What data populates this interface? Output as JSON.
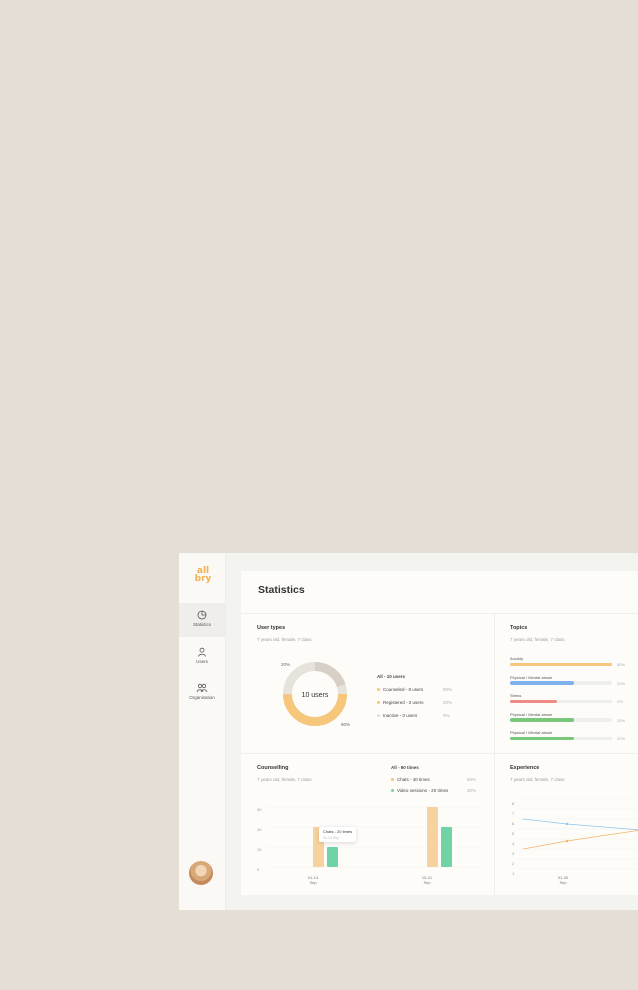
{
  "sidebar": {
    "logo": "all\nbry",
    "items": [
      {
        "label": "Statistics",
        "icon": "pie-chart-icon",
        "active": true
      },
      {
        "label": "Users",
        "icon": "user-icon",
        "active": false
      },
      {
        "label": "Organisation",
        "icon": "group-icon",
        "active": false
      }
    ]
  },
  "page": {
    "title": "Statistics"
  },
  "user_types": {
    "title": "User types",
    "subtitle": "7 years old, female, 7 class",
    "center_label": "10 users",
    "pct_top": "20%",
    "pct_bottom": "80%",
    "summary": "All - 10 users",
    "legend": [
      {
        "label": "Counseled - 8 users",
        "pct": "80%",
        "color": "#f6c67a"
      },
      {
        "label": "Registered - 2 users",
        "pct": "20%",
        "color": "#f6c67a"
      },
      {
        "label": "Inactive - 0 users",
        "pct": "0%",
        "color": "#dddddd"
      }
    ]
  },
  "topics": {
    "title": "Topics",
    "subtitle": "7 years old, female, 7 class",
    "items": [
      {
        "label": "Anxiety",
        "value": 80,
        "pct": "80%",
        "color": "#f6c67a"
      },
      {
        "label": "Physical / Mental abuse",
        "value": 50,
        "pct": "20%",
        "color": "#7fb1ec"
      },
      {
        "label": "Stress",
        "value": 37,
        "pct": "0%",
        "color": "#f08a84"
      },
      {
        "label": "Physical / Mental abuse",
        "value": 50,
        "pct": "20%",
        "color": "#79c77b"
      },
      {
        "label": "Physical / Mental abuse",
        "value": 50,
        "pct": "20%",
        "color": "#79c77b"
      }
    ]
  },
  "counselling": {
    "title": "Counselling",
    "subtitle": "7 years old, female, 7 class",
    "summary": "All - 60 times",
    "legend": [
      {
        "label": "Chats - 40 times",
        "pct": "60%",
        "color": "#f6c67a"
      },
      {
        "label": "Video sessions - 20 times",
        "pct": "30%",
        "color": "#6fd3a5"
      }
    ],
    "y_ticks": [
      "30",
      "20",
      "10",
      "0"
    ],
    "tooltip": {
      "title": "Chats - 20 times",
      "sub": "01-14 Sep"
    },
    "chart_data": {
      "type": "bar",
      "categories": [
        "01-14\nSep",
        "15-21\nSep"
      ],
      "series": [
        {
          "name": "Chats",
          "values": [
            20,
            30
          ],
          "color": "#f6d29e"
        },
        {
          "name": "Video sessions",
          "values": [
            10,
            20
          ],
          "color": "#6fd3a5"
        }
      ],
      "ylim": [
        0,
        30
      ]
    }
  },
  "experience": {
    "title": "Experience",
    "subtitle": "7 years old, female, 7 class",
    "y_ticks": [
      "8",
      "7",
      "6",
      "5",
      "4",
      "3",
      "2",
      "1"
    ],
    "x_label": "01-30\nSep",
    "chart_data": {
      "type": "line",
      "x": [
        0,
        1,
        2
      ],
      "ylim": [
        1,
        8
      ],
      "series": [
        {
          "values": [
            6,
            5.5,
            4.9
          ],
          "color": "#8cc4ec"
        },
        {
          "values": [
            3,
            3.8,
            4.9
          ],
          "color": "#f3b36b"
        }
      ]
    }
  }
}
